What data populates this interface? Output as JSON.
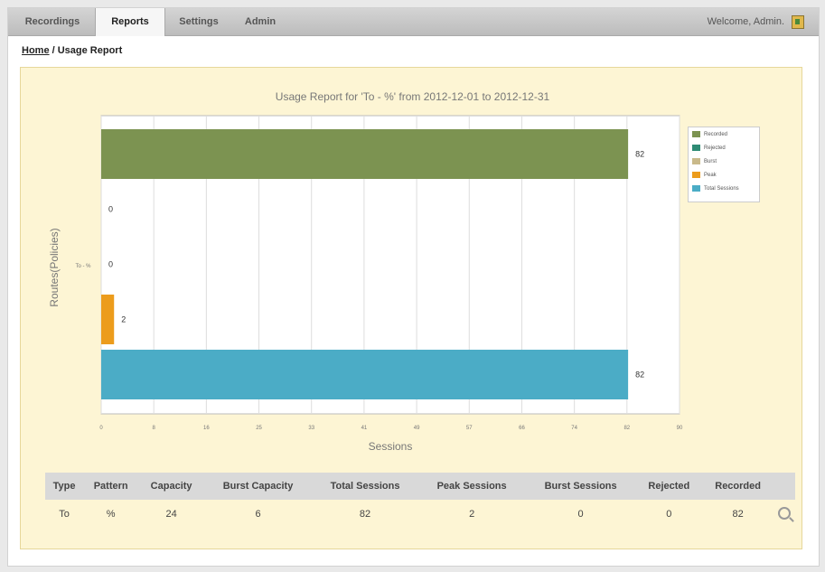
{
  "nav": {
    "tabs": [
      {
        "label": "Recordings",
        "active": false
      },
      {
        "label": "Reports",
        "active": true
      },
      {
        "label": "Settings",
        "active": false
      },
      {
        "label": "Admin",
        "active": false
      }
    ],
    "welcome": "Welcome, Admin."
  },
  "breadcrumb": {
    "home": "Home",
    "sep": " / ",
    "current": "Usage Report"
  },
  "chart_data": {
    "type": "bar",
    "orientation": "horizontal",
    "title": "Usage Report for 'To - %' from 2012-12-01 to 2012-12-31",
    "xlabel": "Sessions",
    "ylabel": "Routes(Policies)",
    "category": "To - %",
    "xlim": [
      0,
      90
    ],
    "xticks": [
      "0",
      "8",
      "16",
      "25",
      "33",
      "41",
      "49",
      "57",
      "66",
      "74",
      "82",
      "90"
    ],
    "grid": true,
    "legend_position": "right",
    "series": [
      {
        "name": "Recorded",
        "value": 82,
        "color": "#7c9351"
      },
      {
        "name": "Rejected",
        "value": 0,
        "color": "#2e8b74"
      },
      {
        "name": "Burst",
        "value": 0,
        "color": "#c9b98a"
      },
      {
        "name": "Peak",
        "value": 2,
        "color": "#ec9c1c"
      },
      {
        "name": "Total Sessions",
        "value": 82,
        "color": "#4bacc6"
      }
    ]
  },
  "table": {
    "headers": [
      "Type",
      "Pattern",
      "Capacity",
      "Burst Capacity",
      "Total Sessions",
      "Peak Sessions",
      "Burst Sessions",
      "Rejected",
      "Recorded"
    ],
    "rows": [
      [
        "To",
        "%",
        "24",
        "6",
        "82",
        "2",
        "0",
        "0",
        "82"
      ]
    ]
  }
}
